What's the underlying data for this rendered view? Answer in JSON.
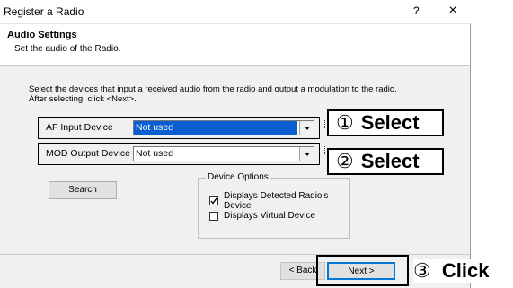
{
  "window": {
    "title": "Register a Radio",
    "help": "?",
    "close": "×"
  },
  "header": {
    "title": "Audio Settings",
    "subtitle": "Set the audio of the Radio."
  },
  "instructions": {
    "line1": "Select the devices that input a received audio from the radio and output a modulation to the radio.",
    "line2": "After selecting, click <Next>."
  },
  "af_input": {
    "label": "AF Input Device",
    "value": "Not used"
  },
  "mod_output": {
    "label": "MOD Output Device",
    "value": "Not used"
  },
  "buttons": {
    "search": "Search",
    "back": "< Back",
    "next": "Next >"
  },
  "device_options": {
    "title": "Device Options",
    "detected": {
      "label": "Displays Detected Radio's Device",
      "checked": true
    },
    "virtual": {
      "label": "Displays Virtual Device",
      "checked": false
    }
  },
  "callouts": {
    "one_num": "①",
    "one_text": "Select",
    "two_num": "②",
    "two_text": "Select",
    "three_num": "③",
    "three_text": "Click"
  },
  "icons": {
    "dropdown": "chevron-down-icon",
    "check": "check-icon"
  }
}
